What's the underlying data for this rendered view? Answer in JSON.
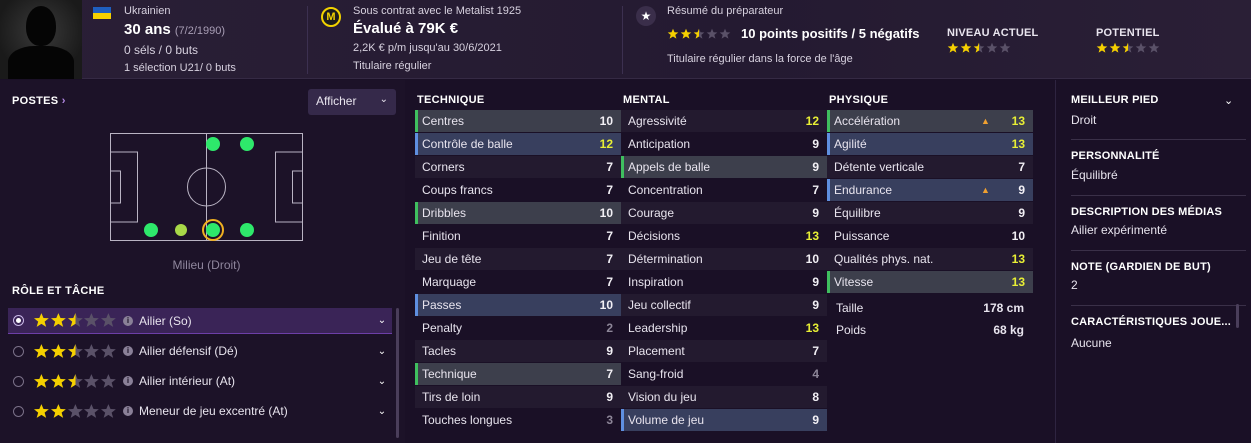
{
  "header": {
    "nationality": "Ukrainien",
    "age": "30 ans",
    "birthdate": "(7/2/1990)",
    "caps": "0 séls / 0 buts",
    "u21": "1 sélection U21/ 0 buts",
    "contract": "Sous contrat avec le Metalist 1925",
    "club_badge": "M",
    "value": "Évalué à 79K €",
    "wage": "2,2K € p/m jusqu'au 30/6/2021",
    "status": "Titulaire régulier",
    "scout_title": "Résumé du préparateur",
    "scout_summary": "10 points positifs / 5 négatifs",
    "scout_stars": 2.5,
    "scout_text": "Titulaire régulier dans la force de l'âge",
    "current_label": "NIVEAU ACTUEL",
    "current_stars": 2.5,
    "potential_label": "POTENTIEL",
    "potential_stars": 2.5
  },
  "positions": {
    "title": "POSTES",
    "button": "Afficher",
    "label": "Milieu (Droit)"
  },
  "roles": {
    "title": "RÔLE ET TÂCHE",
    "items": [
      {
        "name": "Ailier (So)",
        "stars": 2.5,
        "selected": true
      },
      {
        "name": "Ailier défensif (Dé)",
        "stars": 2.5,
        "selected": false
      },
      {
        "name": "Ailier intérieur (At)",
        "stars": 2.5,
        "selected": false
      },
      {
        "name": "Meneur de jeu excentré (At)",
        "stars": 2.0,
        "selected": false
      }
    ]
  },
  "technique": {
    "title": "TECHNIQUE",
    "rows": [
      {
        "name": "Centres",
        "value": "10",
        "hl": "green"
      },
      {
        "name": "Contrôle de balle",
        "value": "12",
        "hl": "blue"
      },
      {
        "name": "Corners",
        "value": "7",
        "hl": ""
      },
      {
        "name": "Coups francs",
        "value": "7",
        "hl": ""
      },
      {
        "name": "Dribbles",
        "value": "10",
        "hl": "green"
      },
      {
        "name": "Finition",
        "value": "7",
        "hl": ""
      },
      {
        "name": "Jeu de tête",
        "value": "7",
        "hl": ""
      },
      {
        "name": "Marquage",
        "value": "7",
        "hl": ""
      },
      {
        "name": "Passes",
        "value": "10",
        "hl": "blue"
      },
      {
        "name": "Penalty",
        "value": "2",
        "hl": ""
      },
      {
        "name": "Tacles",
        "value": "9",
        "hl": ""
      },
      {
        "name": "Technique",
        "value": "7",
        "hl": "green"
      },
      {
        "name": "Tirs de loin",
        "value": "9",
        "hl": ""
      },
      {
        "name": "Touches longues",
        "value": "3",
        "hl": ""
      }
    ]
  },
  "mental": {
    "title": "MENTAL",
    "rows": [
      {
        "name": "Agressivité",
        "value": "12",
        "hl": ""
      },
      {
        "name": "Anticipation",
        "value": "9",
        "hl": ""
      },
      {
        "name": "Appels de balle",
        "value": "9",
        "hl": "green"
      },
      {
        "name": "Concentration",
        "value": "7",
        "hl": ""
      },
      {
        "name": "Courage",
        "value": "9",
        "hl": ""
      },
      {
        "name": "Décisions",
        "value": "13",
        "hl": ""
      },
      {
        "name": "Détermination",
        "value": "10",
        "hl": ""
      },
      {
        "name": "Inspiration",
        "value": "9",
        "hl": ""
      },
      {
        "name": "Jeu collectif",
        "value": "9",
        "hl": ""
      },
      {
        "name": "Leadership",
        "value": "13",
        "hl": ""
      },
      {
        "name": "Placement",
        "value": "7",
        "hl": ""
      },
      {
        "name": "Sang-froid",
        "value": "4",
        "hl": ""
      },
      {
        "name": "Vision du jeu",
        "value": "8",
        "hl": ""
      },
      {
        "name": "Volume de jeu",
        "value": "9",
        "hl": "blue"
      }
    ]
  },
  "physique": {
    "title": "PHYSIQUE",
    "rows": [
      {
        "name": "Accélération",
        "value": "13",
        "hl": "green",
        "arrow": true
      },
      {
        "name": "Agilité",
        "value": "13",
        "hl": "blue",
        "arrow": false
      },
      {
        "name": "Détente verticale",
        "value": "7",
        "hl": "",
        "arrow": false
      },
      {
        "name": "Endurance",
        "value": "9",
        "hl": "blue",
        "arrow": true
      },
      {
        "name": "Équilibre",
        "value": "9",
        "hl": "",
        "arrow": false
      },
      {
        "name": "Puissance",
        "value": "10",
        "hl": "",
        "arrow": false
      },
      {
        "name": "Qualités phys. nat.",
        "value": "13",
        "hl": "",
        "arrow": false
      },
      {
        "name": "Vitesse",
        "value": "13",
        "hl": "green",
        "arrow": false
      }
    ],
    "height_label": "Taille",
    "height": "178 cm",
    "weight_label": "Poids",
    "weight": "68 kg"
  },
  "side": {
    "best_foot_title": "MEILLEUR PIED",
    "best_foot": "Droit",
    "personality_title": "PERSONNALITÉ",
    "personality": "Équilibré",
    "media_title": "DESCRIPTION DES MÉDIAS",
    "media": "Ailier expérimenté",
    "gk_title": "NOTE (GARDIEN DE BUT)",
    "gk": "2",
    "traits_title": "CARACTÉRISTIQUES JOUE...",
    "traits": "Aucune"
  },
  "colors": {
    "star_full": "#f5d000",
    "star_empty": "#5a5168",
    "value_high": "#e8ef35"
  }
}
